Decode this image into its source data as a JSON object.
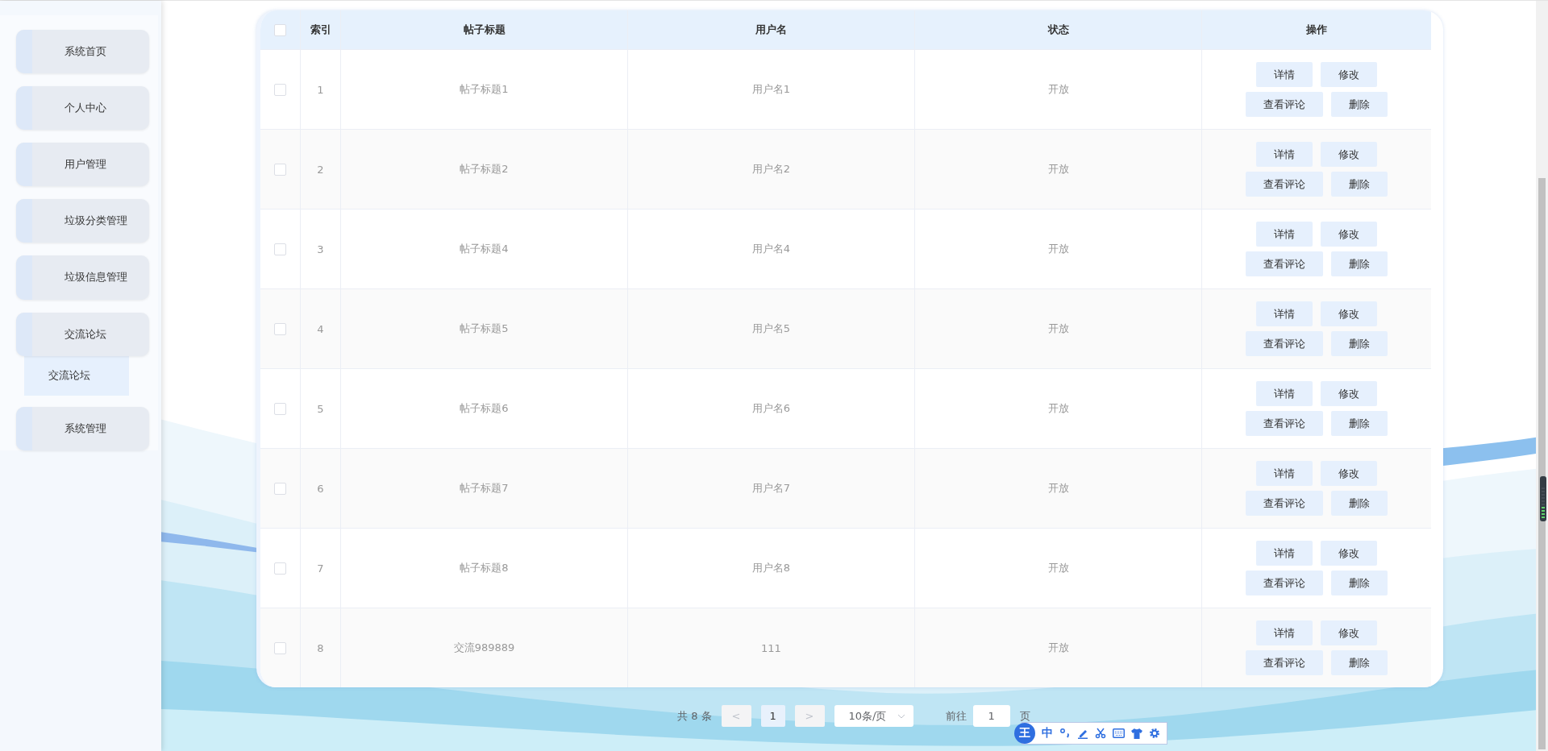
{
  "sidebar": {
    "items": [
      {
        "label": "系统首页"
      },
      {
        "label": "个人中心"
      },
      {
        "label": "用户管理"
      },
      {
        "label": "垃圾分类管理"
      },
      {
        "label": "垃圾信息管理"
      },
      {
        "label": "交流论坛",
        "children": [
          {
            "label": "交流论坛"
          }
        ]
      },
      {
        "label": "系统管理"
      }
    ]
  },
  "table": {
    "header_checkbox": {
      "checked": false
    },
    "columns": [
      "索引",
      "帖子标题",
      "用户名",
      "状态",
      "操作"
    ],
    "rows": [
      {
        "checked": false,
        "index": "1",
        "title": "帖子标题1",
        "username": "用户名1",
        "status": "开放",
        "actions": [
          "详情",
          "修改",
          "查看评论",
          "删除"
        ]
      },
      {
        "checked": false,
        "index": "2",
        "title": "帖子标题2",
        "username": "用户名2",
        "status": "开放",
        "actions": [
          "详情",
          "修改",
          "查看评论",
          "删除"
        ]
      },
      {
        "checked": false,
        "index": "3",
        "title": "帖子标题4",
        "username": "用户名4",
        "status": "开放",
        "actions": [
          "详情",
          "修改",
          "查看评论",
          "删除"
        ]
      },
      {
        "checked": false,
        "index": "4",
        "title": "帖子标题5",
        "username": "用户名5",
        "status": "开放",
        "actions": [
          "详情",
          "修改",
          "查看评论",
          "删除"
        ]
      },
      {
        "checked": false,
        "index": "5",
        "title": "帖子标题6",
        "username": "用户名6",
        "status": "开放",
        "actions": [
          "详情",
          "修改",
          "查看评论",
          "删除"
        ]
      },
      {
        "checked": false,
        "index": "6",
        "title": "帖子标题7",
        "username": "用户名7",
        "status": "开放",
        "actions": [
          "详情",
          "修改",
          "查看评论",
          "删除"
        ]
      },
      {
        "checked": false,
        "index": "7",
        "title": "帖子标题8",
        "username": "用户名8",
        "status": "开放",
        "actions": [
          "详情",
          "修改",
          "查看评论",
          "删除"
        ]
      },
      {
        "checked": false,
        "index": "8",
        "title": "交流989889",
        "username": "111",
        "status": "开放",
        "actions": [
          "详情",
          "修改",
          "查看评论",
          "删除"
        ]
      }
    ]
  },
  "pagination": {
    "total": "共 8 条",
    "prev": "<",
    "pages": [
      {
        "label": "1",
        "selected": true
      }
    ],
    "next": ">",
    "page_size": "10条/页",
    "goto_label": "前往",
    "goto_value": "1",
    "goto_suffix": "页"
  },
  "ime_toolbar": {
    "logo": "王",
    "mode": "中"
  }
}
